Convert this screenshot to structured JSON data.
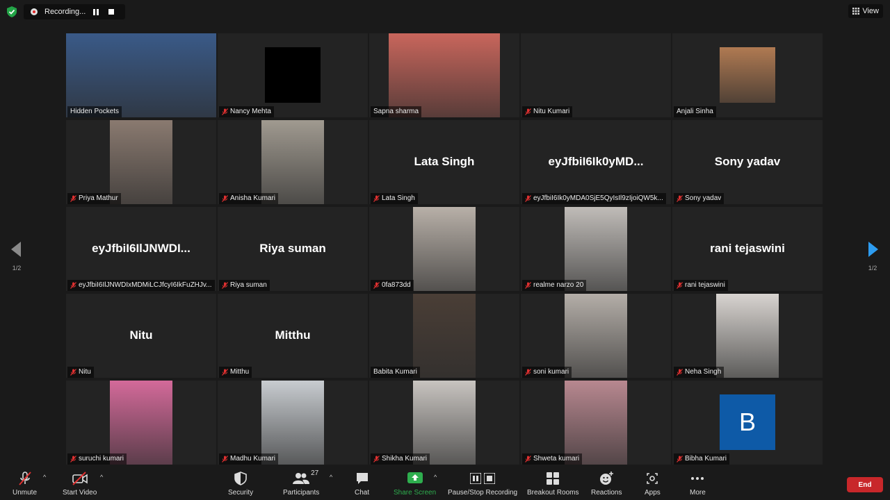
{
  "topbar": {
    "recording_label": "Recording...",
    "view_label": "View"
  },
  "gallery": {
    "page_indicator_left": "1/2",
    "page_indicator_right": "1/2",
    "tiles": [
      {
        "name": "Hidden Pockets",
        "muted": false,
        "display": "video",
        "active": true,
        "color": "#3a5a88"
      },
      {
        "name": "Nancy Mehta",
        "muted": true,
        "display": "black-square"
      },
      {
        "name": "Sapna sharma",
        "muted": false,
        "display": "video",
        "color": "#c9665c"
      },
      {
        "name": "Nitu Kumari",
        "muted": true,
        "display": "blank"
      },
      {
        "name": "Anjali Sinha",
        "muted": false,
        "display": "photo",
        "color": "#b07a52"
      },
      {
        "name": "Priya Mathur",
        "muted": true,
        "display": "video",
        "color": "#8a7a70"
      },
      {
        "name": "Anisha Kumari",
        "muted": true,
        "display": "video",
        "color": "#a09a90"
      },
      {
        "name": "Lata Singh",
        "muted": true,
        "display": "name",
        "big": "Lata Singh"
      },
      {
        "name": "eyJfbiI6Ik0yMDA0SjE5QyIsIl9zIjoiQW5k...",
        "muted": true,
        "display": "name",
        "big": "eyJfbiI6Ik0yMD..."
      },
      {
        "name": "Sony yadav",
        "muted": true,
        "display": "name",
        "big": "Sony yadav"
      },
      {
        "name": "eyJfbiI6IlJNWDIxMDMiLCJfcyI6IkFuZHJv...",
        "muted": true,
        "display": "name",
        "big": "eyJfbiI6IlJNWDI..."
      },
      {
        "name": "Riya suman",
        "muted": true,
        "display": "name",
        "big": "Riya suman"
      },
      {
        "name": "0fa873dd",
        "muted": true,
        "display": "video",
        "color": "#b8b0a8"
      },
      {
        "name": "realme narzo 20",
        "muted": true,
        "display": "video",
        "color": "#c0bcb8"
      },
      {
        "name": "rani tejaswini",
        "muted": true,
        "display": "name",
        "big": "rani tejaswini"
      },
      {
        "name": "Nitu",
        "muted": true,
        "display": "name",
        "big": "Nitu"
      },
      {
        "name": "Mitthu",
        "muted": true,
        "display": "name",
        "big": "Mitthu"
      },
      {
        "name": "Babita Kumari",
        "muted": false,
        "display": "video",
        "color": "#4a3e36"
      },
      {
        "name": "soni kumari",
        "muted": true,
        "display": "video",
        "color": "#b4aea8"
      },
      {
        "name": "Neha Singh",
        "muted": true,
        "display": "video",
        "color": "#d8d4d0"
      },
      {
        "name": "suruchi kumari",
        "muted": true,
        "display": "video",
        "color": "#d46a9a"
      },
      {
        "name": "Madhu Kumari",
        "muted": true,
        "display": "video",
        "color": "#c8ccd0"
      },
      {
        "name": "Shikha Kumari",
        "muted": true,
        "display": "video",
        "color": "#c8c4c0"
      },
      {
        "name": "Shweta kumari",
        "muted": true,
        "display": "video",
        "color": "#b88890"
      },
      {
        "name": "Bibha Kumari",
        "muted": true,
        "display": "avatar",
        "avatar_letter": "B",
        "color": "#0e5aa7"
      }
    ]
  },
  "toolbar": {
    "unmute": "Unmute",
    "start_video": "Start Video",
    "security": "Security",
    "participants": "Participants",
    "participants_count": "27",
    "chat": "Chat",
    "share_screen": "Share Screen",
    "pause_stop_recording": "Pause/Stop Recording",
    "breakout_rooms": "Breakout Rooms",
    "reactions": "Reactions",
    "apps": "Apps",
    "more": "More",
    "end": "End",
    "share_color": "#2eae4e",
    "end_color": "#c8272a"
  }
}
